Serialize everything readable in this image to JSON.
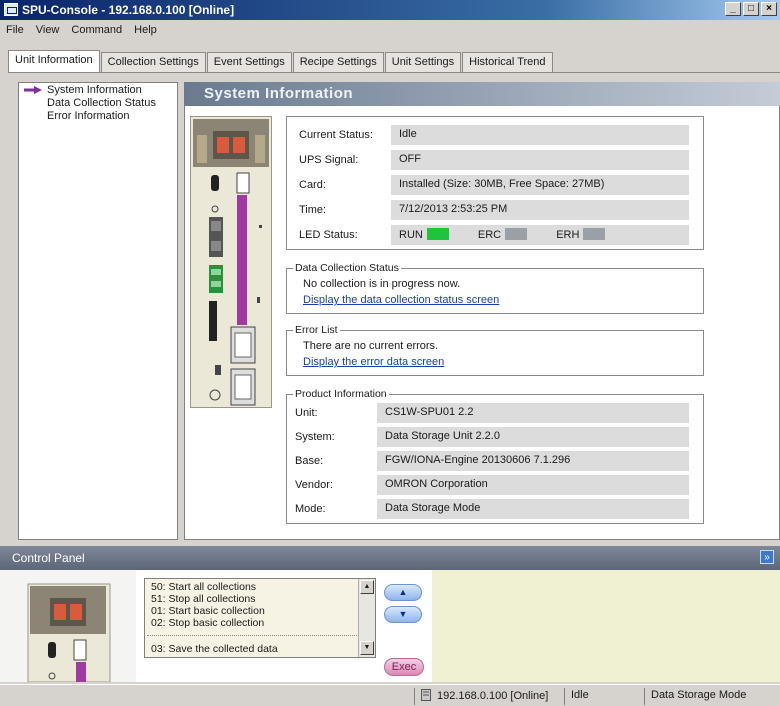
{
  "window": {
    "title": "SPU-Console - 192.168.0.100 [Online]",
    "controls": [
      "_",
      "□",
      "×"
    ]
  },
  "menu": [
    "File",
    "View",
    "Command",
    "Help"
  ],
  "tabs": [
    {
      "label": "Unit Information",
      "active": true
    },
    {
      "label": "Collection Settings",
      "active": false
    },
    {
      "label": "Event Settings",
      "active": false
    },
    {
      "label": "Recipe Settings",
      "active": false
    },
    {
      "label": "Unit Settings",
      "active": false
    },
    {
      "label": "Historical Trend",
      "active": false
    }
  ],
  "nav": {
    "items": [
      {
        "label": "System Information",
        "selected": true
      },
      {
        "label": "Data Collection Status",
        "selected": false
      },
      {
        "label": "Error Information",
        "selected": false
      }
    ]
  },
  "main": {
    "header": "System Information",
    "status": {
      "rows": [
        {
          "label": "Current Status:",
          "value": "Idle"
        },
        {
          "label": "UPS Signal:",
          "value": "OFF"
        },
        {
          "label": "Card:",
          "value": "Installed  (Size: 30MB, Free Space: 27MB)"
        },
        {
          "label": "Time:",
          "value": "7/12/2013 2:53:25 PM"
        }
      ],
      "led_label": "LED Status:",
      "leds": [
        {
          "name": "RUN",
          "color": "#1fc43a"
        },
        {
          "name": "ERC",
          "color": "#9aa0a6"
        },
        {
          "name": "ERH",
          "color": "#9aa0a6"
        }
      ]
    },
    "data_collection": {
      "title": "Data Collection Status",
      "text": "No collection is in progress now.",
      "link": "Display the data collection status screen"
    },
    "error_list": {
      "title": "Error List",
      "text": "There are no current errors.",
      "link": "Display the error data screen"
    },
    "product": {
      "title": "Product Information",
      "rows": [
        {
          "label": "Unit:",
          "value": "CS1W-SPU01        2.2"
        },
        {
          "label": "System:",
          "value": "Data Storage Unit  2.2.0"
        },
        {
          "label": "Base:",
          "value": "FGW/IONA-Engine 20130606  7.1.296"
        },
        {
          "label": "Vendor:",
          "value": "OMRON Corporation"
        },
        {
          "label": "Mode:",
          "value": "Data Storage Mode"
        }
      ]
    }
  },
  "control_panel": {
    "title": "Control Panel",
    "commands": [
      "50: Start all collections",
      "51: Stop all collections",
      "01: Start basic collection",
      "02: Stop basic collection",
      "03: Save the collected data"
    ],
    "up_label": "▲",
    "down_label": "▼",
    "exec_label": "Exec"
  },
  "statusbar": {
    "connection": "192.168.0.100 [Online]",
    "state": "Idle",
    "mode": "Data Storage Mode"
  }
}
